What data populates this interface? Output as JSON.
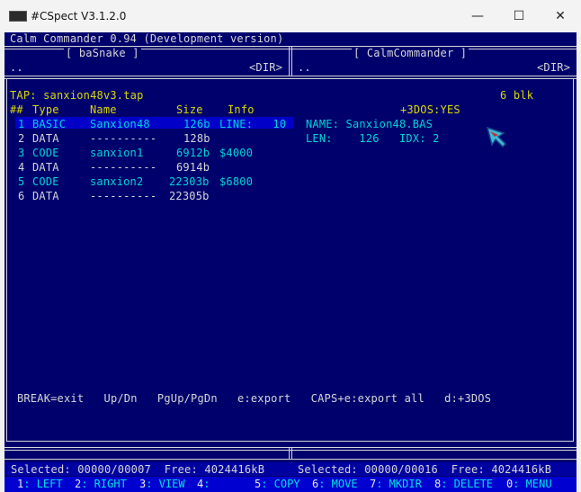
{
  "window": {
    "title": "#CSpect V3.1.2.0",
    "minimize": "—",
    "maximize": "☐",
    "close": "✕"
  },
  "app": {
    "title": "Calm Commander 0.94 (Development version)"
  },
  "left_panel": {
    "title": "[ baSnake ]",
    "path_up": "..",
    "dir_tag": "<DIR>"
  },
  "right_panel": {
    "title": "[ CalmCommander ]",
    "path_up": "..",
    "dir_tag": "<DIR>"
  },
  "tap": {
    "file_label": "TAP: sanxion48v3.tap",
    "plus3dos": "+3DOS:YES",
    "blocks": "6 blk",
    "headers": {
      "num": "##",
      "type": "Type",
      "name": "Name",
      "size": "Size",
      "info": "Info"
    },
    "rows": [
      {
        "num": "1",
        "type": "BASIC",
        "name": "Sanxion48",
        "size": "126b",
        "info": "LINE:   10"
      },
      {
        "num": "2",
        "type": "DATA",
        "name": "----------",
        "size": "128b",
        "info": ""
      },
      {
        "num": "3",
        "type": "CODE",
        "name": "sanxion1",
        "size": "6912b",
        "info": "$4000"
      },
      {
        "num": "4",
        "type": "DATA",
        "name": "----------",
        "size": "6914b",
        "info": ""
      },
      {
        "num": "5",
        "type": "CODE",
        "name": "sanxion2",
        "size": "22303b",
        "info": "$6800"
      },
      {
        "num": "6",
        "type": "DATA",
        "name": "----------",
        "size": "22305b",
        "info": ""
      }
    ],
    "detail": {
      "name_line": "NAME: Sanxion48.BAS",
      "len_line": "LEN:    126   IDX: 2"
    }
  },
  "help_line": "BREAK=exit   Up/Dn   PgUp/PgDn   e:export   CAPS+e:export all   d:+3DOS",
  "status": {
    "left": "Selected: 00000/00007  Free: 4024416kB",
    "right": "Selected: 00000/00016  Free: 4024416kB"
  },
  "fkeys": [
    {
      "num": "1",
      "label": ": LEFT"
    },
    {
      "num": "2",
      "label": ": RIGHT"
    },
    {
      "num": "3",
      "label": ": VIEW"
    },
    {
      "num": "4",
      "label": ":"
    },
    {
      "num": "5",
      "label": ": COPY"
    },
    {
      "num": "6",
      "label": ": MOVE"
    },
    {
      "num": "7",
      "label": ": MKDIR"
    },
    {
      "num": "8",
      "label": ": DELETE"
    },
    {
      "num": "0",
      "label": ": MENU"
    }
  ],
  "colors": {
    "bg": "#00006d",
    "white": "#d6d6d6",
    "yellow": "#d8d800",
    "cyan": "#00d4d4",
    "selection": "#0000c8",
    "fkey_bar": "#0000d0"
  }
}
